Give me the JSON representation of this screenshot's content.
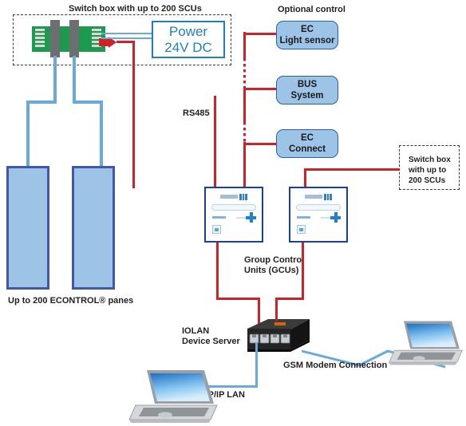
{
  "diagram": {
    "title_top": "Switch box with up to 200 SCUs",
    "labels": {
      "optional_control": "Optional control",
      "rs485": "RS485",
      "gcu": "Group Control\nUnits (GCUs)",
      "panes": "Up to 200 ECONTROL® panes",
      "iolan": "IOLAN\nDevice Server",
      "tcpip": "TCP/IP LAN",
      "gsm": "GSM Modem Connection",
      "switchbox_right": "Switch box\nwith up to\n200 SCUs"
    },
    "power": {
      "line1": "Power",
      "line2": "24V DC"
    },
    "optional_controls": [
      {
        "line1": "EC",
        "line2": "Light sensor"
      },
      {
        "line1": "BUS",
        "line2": "System"
      },
      {
        "line1": "EC",
        "line2": "Connect"
      }
    ],
    "colors": {
      "red_wire": "#cc2229",
      "blue_wire": "#69aadd",
      "pane_fill": "#9dc3e6",
      "pane_border": "#4257a8",
      "power_blue": "#1f7fc4",
      "gcu_border": "#1f3f8f",
      "pcb_green": "#1d9a4e"
    }
  }
}
